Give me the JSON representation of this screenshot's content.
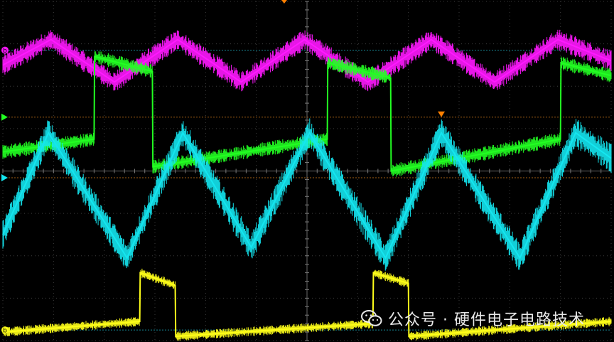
{
  "chart_data": {
    "type": "line",
    "instrument": "oscilloscope",
    "divisions": {
      "x": 12,
      "y": 8
    },
    "grid": true,
    "title": "",
    "xlabel": "",
    "ylabel": "",
    "xlim": [
      0,
      12
    ],
    "ylim": [
      0,
      8
    ],
    "x_unit": "divisions",
    "y_unit": "divisions",
    "channels": [
      {
        "color": "#ff18ff",
        "marker_label": "b",
        "waveform": "triangle",
        "reference_level": 6.85,
        "points": [
          [
            0.0,
            6.5
          ],
          [
            0.95,
            7.1
          ],
          [
            2.2,
            6.1
          ],
          [
            3.45,
            7.1
          ],
          [
            4.7,
            6.1
          ],
          [
            5.95,
            7.1
          ],
          [
            7.2,
            6.1
          ],
          [
            8.45,
            7.1
          ],
          [
            9.7,
            6.1
          ],
          [
            10.95,
            7.1
          ],
          [
            12.0,
            6.6
          ]
        ],
        "noise": 0.18
      },
      {
        "color": "#22ff22",
        "marker_label": "",
        "waveform": "sawtooth",
        "reference_level": 5.27,
        "points": [
          [
            0.0,
            4.45
          ],
          [
            1.8,
            4.75
          ],
          [
            1.81,
            6.7
          ],
          [
            2.95,
            6.35
          ],
          [
            2.96,
            4.1
          ],
          [
            6.4,
            4.75
          ],
          [
            6.41,
            6.55
          ],
          [
            7.65,
            6.2
          ],
          [
            7.66,
            4.0
          ],
          [
            11.0,
            4.75
          ],
          [
            11.01,
            6.55
          ],
          [
            12.0,
            6.25
          ]
        ],
        "noise": 0.12
      },
      {
        "color": "#14e6f0",
        "marker_label": "",
        "waveform": "triangle",
        "reference_level": 3.84,
        "points": [
          [
            0.0,
            2.5
          ],
          [
            0.9,
            4.9
          ],
          [
            2.45,
            1.95
          ],
          [
            3.55,
            4.9
          ],
          [
            4.9,
            2.2
          ],
          [
            6.05,
            4.9
          ],
          [
            7.55,
            1.95
          ],
          [
            8.65,
            4.9
          ],
          [
            10.2,
            1.95
          ],
          [
            11.3,
            4.9
          ],
          [
            12.0,
            4.3
          ]
        ],
        "noise": 0.25
      },
      {
        "color": "#ffff1a",
        "marker_label": "b",
        "waveform": "sawtooth",
        "reference_level": 0.25,
        "points": [
          [
            0.0,
            0.2
          ],
          [
            2.7,
            0.45
          ],
          [
            2.71,
            1.6
          ],
          [
            3.4,
            1.3
          ],
          [
            3.41,
            0.1
          ],
          [
            7.3,
            0.4
          ],
          [
            7.31,
            1.6
          ],
          [
            8.0,
            1.35
          ],
          [
            8.01,
            0.1
          ],
          [
            12.0,
            0.45
          ]
        ],
        "noise": 0.08
      }
    ],
    "trigger_marker": {
      "x": 8.65,
      "color": "#ff8000"
    },
    "top_marker": {
      "x": 5.55,
      "color": "#ff8000"
    }
  },
  "watermark": {
    "text": "公众号 · 硬件电子电路技术",
    "icon": "wechat-icon"
  }
}
